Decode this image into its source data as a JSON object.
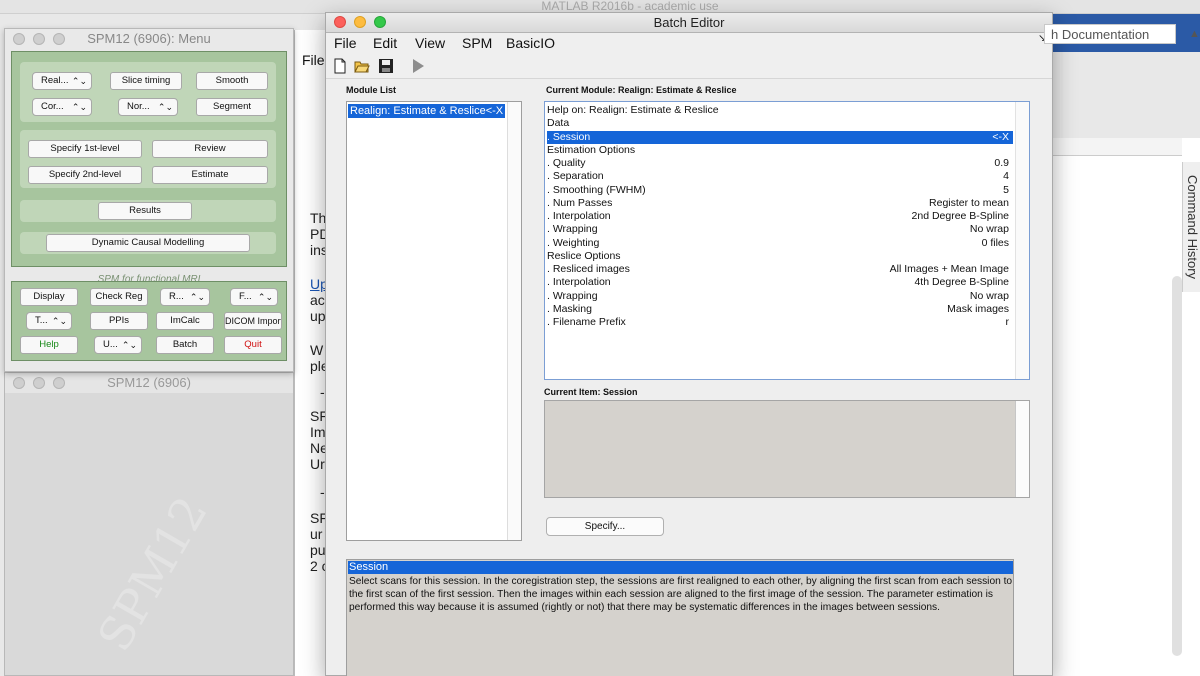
{
  "matlab": {
    "title": "MATLAB R2016b - academic use",
    "search_placeholder": "h Documentation",
    "command_history": "Command History",
    "doc_menu_file": "File",
    "doc_lines": [
      "Th",
      "PD",
      "ins",
      "Up",
      "ac",
      "up",
      "W",
      "ple",
      "-",
      "SF",
      "Im",
      "Ne",
      "Ur",
      "-",
      "SF",
      "ur",
      "pu",
      "2 c"
    ]
  },
  "spm_menu": {
    "title": "SPM12 (6906): Menu",
    "buttons": {
      "realign": "Real...",
      "slice_timing": "Slice timing",
      "smooth": "Smooth",
      "coregister": "Cor...",
      "normalise": "Nor...",
      "segment": "Segment",
      "specify_1st": "Specify 1st-level",
      "review": "Review",
      "specify_2nd": "Specify 2nd-level",
      "estimate": "Estimate",
      "results": "Results",
      "dcm": "Dynamic Causal Modelling",
      "display": "Display",
      "check_reg": "Check Reg",
      "render": "R...",
      "fmri": "F...",
      "toolbox": "T...",
      "ppis": "PPIs",
      "imcalc": "ImCalc",
      "dicom": "DICOM Import",
      "help": "Help",
      "utils": "U...",
      "batch": "Batch",
      "quit": "Quit"
    },
    "tagline": "SPM for functional MRI",
    "colors": {
      "panel": "#a7c59e",
      "help": "#1a8a1a",
      "quit": "#d01010"
    }
  },
  "spm_graphics": {
    "title": "SPM12 (6906)",
    "watermark": "SPM12"
  },
  "batch_editor": {
    "title": "Batch Editor",
    "menu": [
      "File",
      "Edit",
      "View",
      "SPM",
      "BasicIO"
    ],
    "toolbar_icons": [
      "new-file-icon",
      "open-folder-icon",
      "save-icon",
      "run-icon"
    ],
    "module_list_label": "Module List",
    "module_list_items": [
      "Realign: Estimate & Reslice<-X"
    ],
    "current_module_label": "Current Module: Realign: Estimate & Reslice",
    "current_module_rows": [
      {
        "label": "Help on: Realign: Estimate & Reslice",
        "value": ""
      },
      {
        "label": "Data",
        "value": ""
      },
      {
        "label": ". Session",
        "value": "<-X",
        "selected": true
      },
      {
        "label": "Estimation Options",
        "value": ""
      },
      {
        "label": ". Quality",
        "value": "0.9"
      },
      {
        "label": ". Separation",
        "value": "4"
      },
      {
        "label": ". Smoothing (FWHM)",
        "value": "5"
      },
      {
        "label": ". Num Passes",
        "value": "Register to mean"
      },
      {
        "label": ". Interpolation",
        "value": "2nd Degree B-Spline"
      },
      {
        "label": ". Wrapping",
        "value": "No wrap"
      },
      {
        "label": ". Weighting",
        "value": "0 files"
      },
      {
        "label": "Reslice Options",
        "value": ""
      },
      {
        "label": ". Resliced images",
        "value": "All Images + Mean Image"
      },
      {
        "label": ". Interpolation",
        "value": "4th Degree B-Spline"
      },
      {
        "label": ". Wrapping",
        "value": "No wrap"
      },
      {
        "label": ". Masking",
        "value": "Mask images"
      },
      {
        "label": ". Filename Prefix",
        "value": "r"
      }
    ],
    "current_item_label": "Current Item: Session",
    "specify_button": "Specify...",
    "help_title": "Session",
    "help_text": "Select  scans for this session. In the coregistration step, the sessions are first realigned to each other, by aligning the first scan from each  session to the first scan of the first session.  Then the images within each session are aligned to the first image of the session. The parameter estimation is performed this way because it is assumed (rightly or not) that there may be systematic differences in the images between sessions.",
    "colors": {
      "selection": "#1565d8"
    }
  }
}
